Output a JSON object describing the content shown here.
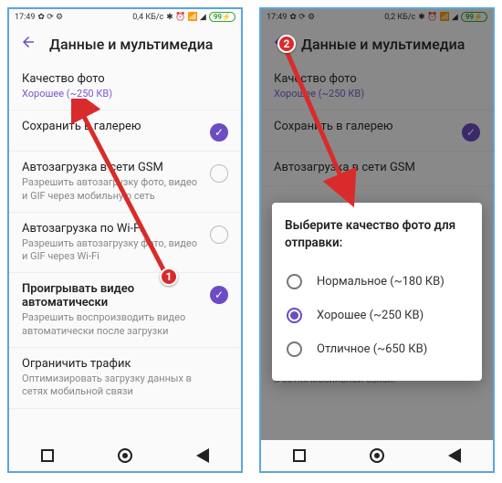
{
  "status": {
    "time": "17:49",
    "net1": "0,4 КБ/с",
    "net2": "0,2 КБ/с",
    "batt": "99"
  },
  "header": {
    "title": "Данные и мультимедиа"
  },
  "rows": {
    "quality_t": "Качество фото",
    "quality_s": "Хорошее (~250 КВ)",
    "save_t": "Сохранить в галерею",
    "gsm_t": "Автозагрузка в сети GSM",
    "gsm_s": "Разрешить автозагрузку фото, видео и GIF через мобильную сеть",
    "wifi_t": "Автозагрузка по Wi-Fi",
    "wifi_s": "Разрешить автозагрузку фото, видео и GIF через Wi-Fi",
    "play_t": "Проигрывать видео автоматически",
    "play_s": "Разрешить воспроизводить видео автоматически после загрузки",
    "limit_t": "Ограничить трафик",
    "limit_s": "Оптимизировать загрузку данных в сетях мобильной связи",
    "limit_s2": "Оптимизировать загрузку данных в сетях мобильной связи."
  },
  "dialog": {
    "title": "Выберите качество фото для отправки:",
    "opt1": "Нормальное (~180 КВ)",
    "opt2": "Хорошее (~250 КВ)",
    "opt3": "Отличное (~650 КВ)"
  },
  "badges": {
    "b1": "1",
    "b2": "2"
  }
}
